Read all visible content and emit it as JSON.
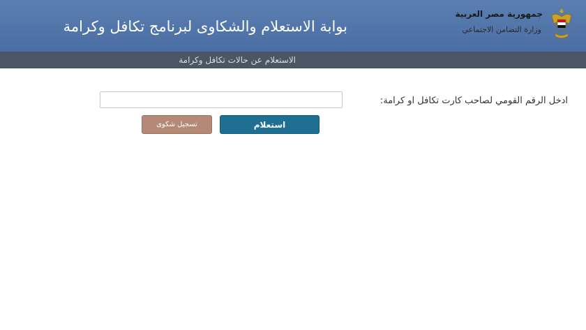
{
  "header": {
    "government_name": "جمهورية مصر العربية",
    "ministry_name": "وزارة التضامن الاجتماعي",
    "portal_title": "بوابة الاستعلام والشكاوى لبرنامج تكافل وكرامة",
    "emblem_icon": "egypt-eagle-emblem-icon",
    "background_color": "#4f73a8"
  },
  "subnav": {
    "link_label": "الاستعلام عن حالات تكافل وكرامة",
    "background_color": "#4a5663"
  },
  "form": {
    "national_id_label": "ادخل الرقم القومي لصاحب كارت تكافل او كرامة:",
    "national_id_value": "",
    "inquiry_button_label": "استعلام",
    "complaint_button_label": "تسجيل شكوى",
    "inquiry_button_color": "#1e6f92",
    "complaint_button_color": "#b48a76"
  }
}
